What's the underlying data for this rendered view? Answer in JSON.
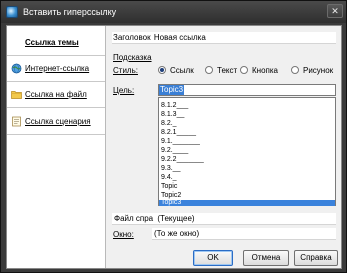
{
  "window": {
    "title": "Вставить гиперссылку",
    "close_glyph": "✕"
  },
  "nav": {
    "items": [
      {
        "label": "Ссылка темы",
        "icon": "topic-link-icon"
      },
      {
        "label": "Интернет-ссылка",
        "icon": "globe-icon"
      },
      {
        "label": "Ссылка на файл",
        "icon": "folder-icon"
      },
      {
        "label": "Ссылка сценария",
        "icon": "script-icon"
      }
    ]
  },
  "form": {
    "title_label": "Заголовок",
    "title_value": "Новая ссылка",
    "tooltip_label": "Подсказка",
    "style_label": "Стиль:",
    "style_options": [
      "Ссылк",
      "Текст",
      "Кнопка",
      "Рисунок"
    ],
    "style_selected": "Ссылк",
    "target_label": "Цель:",
    "target_value": "Topic3",
    "target_list": [
      "8.1.2___",
      "8.1.3__",
      "8.2._",
      "8.2.1_____",
      "9.1._______",
      "9.2.____",
      "9.2.2_______",
      "9.3.__",
      "9.4._",
      "Topic",
      "Topic2",
      "Topic3"
    ],
    "target_selected": "Topic3",
    "file_label": "Файл спра",
    "file_value": "(Текущее)",
    "window_label": "Окно:",
    "window_value": "(То же окно)"
  },
  "buttons": {
    "ok": "OK",
    "cancel": "Отмена",
    "help": "Справка"
  },
  "colors": {
    "selection": "#3a82dc",
    "window_chrome": "#3a3a3a"
  }
}
